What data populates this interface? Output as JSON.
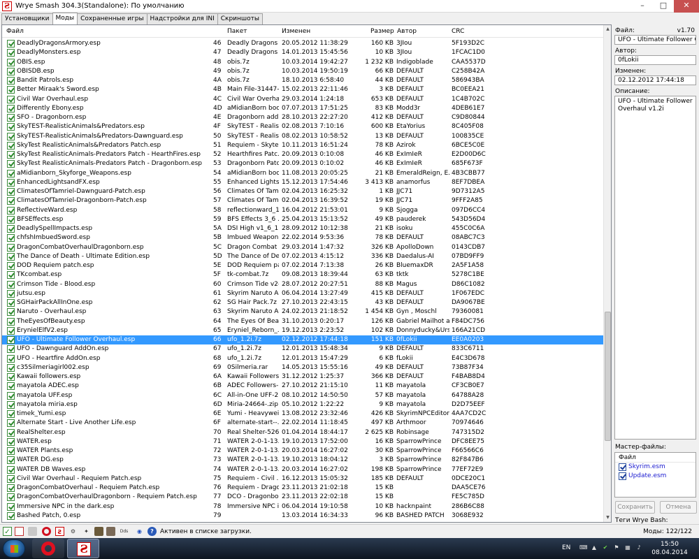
{
  "window": {
    "title": "Wrye Smash 304.3(Standalone): По умолчанию"
  },
  "tabs": [
    {
      "label": "Установщики"
    },
    {
      "label": "Моды"
    },
    {
      "label": "Сохраненные игры"
    },
    {
      "label": "Надстройки для INI"
    },
    {
      "label": "Скриншоты"
    }
  ],
  "list": {
    "columns": {
      "file": "Файл",
      "package": "Пакет",
      "modified": "Изменен",
      "size": "Размер",
      "author": "Автор",
      "crc": "CRC"
    },
    "rows": [
      {
        "file": "DeadlyDragonsArmory.esp",
        "ord": "46",
        "pkg": "Deadly Dragons ...",
        "date": "20.05.2012 11:38:29",
        "size": "160 KB",
        "author": "3JIou",
        "crc": "5F193D2C"
      },
      {
        "file": "DeadlyMonsters.esp",
        "ord": "47",
        "pkg": "Deadly Dragons ...",
        "date": "14.01.2013 15:45:56",
        "size": "10 KB",
        "author": "3JIou",
        "crc": "1FCAC1D0"
      },
      {
        "file": "OBIS.esp",
        "ord": "48",
        "pkg": "obis.7z",
        "date": "10.03.2014 19:42:27",
        "size": "1 232 KB",
        "author": "Indigoblade",
        "crc": "CAA5537D"
      },
      {
        "file": "OBISDB.esp",
        "ord": "49",
        "pkg": "obis.7z",
        "date": "10.03.2014 19:50:19",
        "size": "66 KB",
        "author": "DEFAULT",
        "crc": "C258B42A"
      },
      {
        "file": "Bandit Patrols.esp",
        "ord": "4A",
        "pkg": "obis.7z",
        "date": "18.10.2013 6:58:40",
        "size": "44 KB",
        "author": "DEFAULT",
        "crc": "586943BA"
      },
      {
        "file": "Better Miraak's Sword.esp",
        "ord": "4B",
        "pkg": "Main File-31447-...",
        "date": "15.02.2013 22:11:46",
        "size": "3 KB",
        "author": "DEFAULT",
        "crc": "BC0EEA21"
      },
      {
        "file": "Civil War Overhaul.esp",
        "ord": "4C",
        "pkg": "Civil War Overha...",
        "date": "29.03.2014 1:24:18",
        "size": "653 KB",
        "author": "DEFAULT",
        "crc": "1C4B702C"
      },
      {
        "file": "Differently Ebony.esp",
        "ord": "4D",
        "pkg": "aMidianBorn boo...",
        "date": "07.07.2013 17:51:25",
        "size": "83 KB",
        "author": "Modd3r",
        "crc": "4DEB61E7"
      },
      {
        "file": "SFO - Dragonborn.esp",
        "ord": "4E",
        "pkg": "Dragonborn add...",
        "date": "28.10.2013 22:27:20",
        "size": "412 KB",
        "author": "DEFAULT",
        "crc": "C9D80844"
      },
      {
        "file": "SkyTEST-RealisticAnimals&Predators.esp",
        "ord": "4F",
        "pkg": "SkyTEST - Realis...",
        "date": "02.08.2013 7:10:16",
        "size": "600 KB",
        "author": "EtaYorius",
        "crc": "8C405F08"
      },
      {
        "file": "SkyTEST-RealisticAnimals&Predators-Dawnguard.esp",
        "ord": "50",
        "pkg": "SkyTEST - Realis...",
        "date": "08.02.2013 10:58:52",
        "size": "13 KB",
        "author": "DEFAULT",
        "crc": "100835CE"
      },
      {
        "file": "SkyTest RealisticAnimals&Predators Patch.esp",
        "ord": "51",
        "pkg": "Requiem - Skyte...",
        "date": "10.11.2013 16:51:24",
        "size": "78 KB",
        "author": "Azirok",
        "crc": "6BCE5C0E"
      },
      {
        "file": "SkyTest RealisticAnimals-Predators Patch - HearthFires.esp",
        "ord": "52",
        "pkg": "Hearthfires Patc...",
        "date": "20.09.2013 0:10:08",
        "size": "46 KB",
        "author": "ExImIeR",
        "crc": "E2D00D6C"
      },
      {
        "file": "SkyTest RealisticAnimals-Predators Patch - Dragonborn.esp",
        "ord": "53",
        "pkg": "Dragonborn Patc...",
        "date": "20.09.2013 0:10:02",
        "size": "46 KB",
        "author": "ExImIeR",
        "crc": "685F673F"
      },
      {
        "file": "aMidianborn_Skyforge_Weapons.esp",
        "ord": "54",
        "pkg": "aMidianBorn boo...",
        "date": "11.08.2013 20:05:25",
        "size": "21 KB",
        "author": "EmeraldReign, E...",
        "crc": "4B3CBB77"
      },
      {
        "file": "EnhancedLightsandFX.esp",
        "ord": "55",
        "pkg": "Enhanced Lights ...",
        "date": "15.12.2013 17:54:46",
        "size": "3 413 KB",
        "author": "anamorfus",
        "crc": "8EF7DBEA"
      },
      {
        "file": "ClimatesOfTamriel-Dawnguard-Patch.esp",
        "ord": "56",
        "pkg": "Climates Of Tamr...",
        "date": "02.04.2013 16:25:32",
        "size": "1 KB",
        "author": "JJC71",
        "crc": "9D7312A5"
      },
      {
        "file": "ClimatesOfTamriel-Dragonborn-Patch.esp",
        "ord": "57",
        "pkg": "Climates Of Tamr...",
        "date": "02.04.2013 16:39:52",
        "size": "19 KB",
        "author": "JJC71",
        "crc": "9FFF2A85"
      },
      {
        "file": "ReflectiveWard.esp",
        "ord": "58",
        "pkg": "reflectionward_1...",
        "date": "16.04.2012 21:53:01",
        "size": "9 KB",
        "author": "Sjogga",
        "crc": "097D6CC4"
      },
      {
        "file": "BFSEffects.esp",
        "ord": "59",
        "pkg": "BFS Effects 3_6 ...",
        "date": "25.04.2013 15:13:52",
        "size": "49 KB",
        "author": "pauderek",
        "crc": "543D56D4"
      },
      {
        "file": "DeadlySpellImpacts.esp",
        "ord": "5A",
        "pkg": "DSI High v1_6_1...",
        "date": "28.09.2012 10:12:38",
        "size": "21 KB",
        "author": "isoku",
        "crc": "455C0C6A"
      },
      {
        "file": "chfshImbuedSword.esp",
        "ord": "5B",
        "pkg": "Imbued Weapon...",
        "date": "22.02.2014 9:53:36",
        "size": "78 KB",
        "author": "DEFAULT",
        "crc": "08ABC7C3"
      },
      {
        "file": "DragonCombatOverhaulDragonborn.esp",
        "ord": "5C",
        "pkg": "Dragon Combat ...",
        "date": "29.03.2014 1:47:32",
        "size": "326 KB",
        "author": "ApolloDown",
        "crc": "0143CDB7"
      },
      {
        "file": "The Dance of Death - Ultimate Edition.esp",
        "ord": "5D",
        "pkg": "The Dance of De...",
        "date": "07.02.2013 4:15:12",
        "size": "336 KB",
        "author": "Daedalus-AI",
        "crc": "07BD9FF9"
      },
      {
        "file": "DOD Requiem patch.esp",
        "ord": "5E",
        "pkg": "DOD Requiem pa...",
        "date": "07.02.2014 7:13:38",
        "size": "26 KB",
        "author": "BluemaxDR",
        "crc": "2A5F1A58"
      },
      {
        "file": "TKcombat.esp",
        "ord": "5F",
        "pkg": "tk-combat.7z",
        "date": "09.08.2013 18:39:44",
        "size": "63 KB",
        "author": "tktk",
        "crc": "5278C1BE"
      },
      {
        "file": "Crimson Tide - Blood.esp",
        "ord": "60",
        "pkg": "Crimson Tide v2-...",
        "date": "28.07.2012 20:27:51",
        "size": "88 KB",
        "author": "Magus",
        "crc": "D86C1082"
      },
      {
        "file": "jutsu.esp",
        "ord": "61",
        "pkg": "Skyrim Naruto A...",
        "date": "06.04.2014 13:27:49",
        "size": "415 KB",
        "author": "DEFAULT",
        "crc": "1F067EDC"
      },
      {
        "file": "SGHairPackAllInOne.esp",
        "ord": "62",
        "pkg": "SG Hair Pack.7z",
        "date": "27.10.2013 22:43:15",
        "size": "43 KB",
        "author": "DEFAULT",
        "crc": "DA9067BE"
      },
      {
        "file": "Naruto - Overhaul.esp",
        "ord": "63",
        "pkg": "Skyrim Naruto A...",
        "date": "24.02.2013 21:18:52",
        "size": "1 454 KB",
        "author": "Gyn , Moschl",
        "crc": "79360081"
      },
      {
        "file": "TheEyesOfBeauty.esp",
        "ord": "64",
        "pkg": "The Eyes Of Bea...",
        "date": "31.10.2013 0:20:17",
        "size": "126 KB",
        "author": "Gabriel Mailhot a...",
        "crc": "F84DC756"
      },
      {
        "file": "ErynielElfV2.esp",
        "ord": "65",
        "pkg": "Eryniel_Reborn_...",
        "date": "19.12.2013 2:23:52",
        "size": "102 KB",
        "author": "Donnyducky&Urshi",
        "crc": "166A21CD"
      },
      {
        "file": "UFO - Ultimate Follower Overhaul.esp",
        "ord": "66",
        "pkg": "ufo_1.2i.7z",
        "date": "02.12.2012 17:44:18",
        "size": "151 KB",
        "author": "0fLokii",
        "crc": "EE0A0203",
        "selected": true
      },
      {
        "file": "UFO - Dawnguard AddOn.esp",
        "ord": "67",
        "pkg": "ufo_1.2i.7z",
        "date": "12.01.2013 15:48:34",
        "size": "9 KB",
        "author": "DEFAULT",
        "crc": "833C6711"
      },
      {
        "file": "UFO - Heartfire AddOn.esp",
        "ord": "68",
        "pkg": "ufo_1.2i.7z",
        "date": "12.01.2013 15:47:29",
        "size": "6 KB",
        "author": "fLokii",
        "crc": "E4C3D678"
      },
      {
        "file": "c35Silmeriagirl002.esp",
        "ord": "69",
        "pkg": "0Silmeria.rar",
        "date": "14.05.2013 15:55:16",
        "size": "49 KB",
        "author": "DEFAULT",
        "crc": "73B87F34"
      },
      {
        "file": "Kawaii followers.esp",
        "ord": "6A",
        "pkg": "Kawaii Followers ...",
        "date": "31.12.2012 1:25:37",
        "size": "366 KB",
        "author": "DEFAULT",
        "crc": "F4BAB8D4"
      },
      {
        "file": "mayatola ADEC.esp",
        "ord": "6B",
        "pkg": "ADEC Followers-...",
        "date": "27.10.2012 21:15:10",
        "size": "11 KB",
        "author": "mayatola",
        "crc": "CF3CB0E7"
      },
      {
        "file": "mayatola UFF.esp",
        "ord": "6C",
        "pkg": "All-in-One UFF-2...",
        "date": "08.10.2012 14:50:50",
        "size": "57 KB",
        "author": "mayatola",
        "crc": "64788A28"
      },
      {
        "file": "mayatola miria.esp",
        "ord": "6D",
        "pkg": "Miria-24664-.zip",
        "date": "05.10.2012 1:22:22",
        "size": "9 KB",
        "author": "mayatola",
        "crc": "D2D75EEF"
      },
      {
        "file": "timek_Yumi.esp",
        "ord": "6E",
        "pkg": "Yumi - Heavywei...",
        "date": "13.08.2012 23:32:46",
        "size": "426 KB",
        "author": "SkyrimNPCEditor...",
        "crc": "4AA7CD2C"
      },
      {
        "file": "Alternate Start - Live Another Life.esp",
        "ord": "6F",
        "pkg": "alternate-start--...",
        "date": "22.02.2014 11:18:45",
        "size": "497 KB",
        "author": "Arthmoor",
        "crc": "70974646"
      },
      {
        "file": "RealShelter.esp",
        "ord": "70",
        "pkg": "Real Shelter-526...",
        "date": "01.04.2014 18:44:17",
        "size": "2 625 KB",
        "author": "Robinsage",
        "crc": "747315D2"
      },
      {
        "file": "WATER.esp",
        "ord": "71",
        "pkg": "WATER 2-0-1-13...",
        "date": "19.10.2013 17:52:00",
        "size": "16 KB",
        "author": "SparrowPrince",
        "crc": "DFC8EE75"
      },
      {
        "file": "WATER Plants.esp",
        "ord": "72",
        "pkg": "WATER 2-0-1-13...",
        "date": "20.03.2014 16:27:02",
        "size": "30 KB",
        "author": "SparrowPrince",
        "crc": "F66566C6"
      },
      {
        "file": "WATER DG.esp",
        "ord": "73",
        "pkg": "WATER 2-0-1-13...",
        "date": "19.10.2013 18:04:12",
        "size": "3 KB",
        "author": "SparrowPrince",
        "crc": "82F847B6"
      },
      {
        "file": "WATER DB Waves.esp",
        "ord": "74",
        "pkg": "WATER 2-0-1-13...",
        "date": "20.03.2014 16:27:02",
        "size": "198 KB",
        "author": "SparrowPrince",
        "crc": "77EF72E9"
      },
      {
        "file": "Civil War Overhaul - Requiem Patch.esp",
        "ord": "75",
        "pkg": "Requiem - Civil ...",
        "date": "16.12.2013 15:05:32",
        "size": "185 KB",
        "author": "DEFAULT",
        "crc": "0DCE20C1"
      },
      {
        "file": "DragonCombatOverhaul - Requiem Patch.esp",
        "ord": "76",
        "pkg": "Requiem - Drago...",
        "date": "23.11.2013 21:02:18",
        "size": "15 KB",
        "author": "",
        "crc": "DAA5CE76"
      },
      {
        "file": "DragonCombatOverhaulDragonborn - Requiem Patch.esp",
        "ord": "77",
        "pkg": "DCO - Dragonbo...",
        "date": "23.11.2013 22:02:18",
        "size": "15 KB",
        "author": "",
        "crc": "FE5C785D"
      },
      {
        "file": "Immersive NPC in the dark.esp",
        "ord": "78",
        "pkg": "Immersive NPC i...",
        "date": "06.04.2014 19:10:58",
        "size": "10 KB",
        "author": "hacknpaint",
        "crc": "286B6C88"
      },
      {
        "file": "Bashed Patch, 0.esp",
        "ord": "79",
        "pkg": "",
        "date": "13.03.2014 16:34:33",
        "size": "96 KB",
        "author": "BASHED PATCH",
        "crc": "3068E932"
      }
    ]
  },
  "details": {
    "file_label": "Файл:",
    "version": "v1.70",
    "file_value": "UFO - Ultimate Follower Overhaul.esp",
    "author_label": "Автор:",
    "author_value": "0fLokii",
    "modified_label": "Изменен:",
    "modified_value": "02.12.2012 17:44:18",
    "description_label": "Описание:",
    "description_value": "UFO - Ultimate Follower Overhaul v1.2i",
    "masters_label": "Мастер-файлы:",
    "masters_header": "Файл",
    "masters": [
      {
        "name": "Skyrim.esm"
      },
      {
        "name": "Update.esm"
      }
    ],
    "save_button": "Сохранить",
    "cancel_button": "Отмена",
    "tags_label": "Теги Wrye Bash:"
  },
  "status": {
    "message": "Активен в списке загрузки.",
    "mods_count": "Моды: 122/122"
  },
  "taskbar": {
    "lang": "EN",
    "time": "15:50",
    "date": "08.04.2014"
  }
}
